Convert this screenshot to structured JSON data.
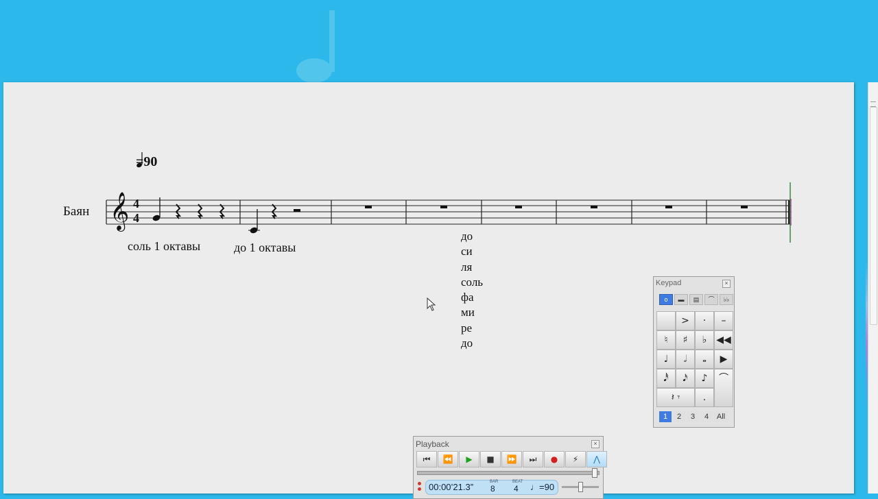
{
  "score": {
    "instrument": "Баян",
    "tempo_value": "=90",
    "time_signature": {
      "top": "4",
      "bottom": "4"
    },
    "lyrics": [
      "соль 1 октавы",
      "до 1 октавы"
    ],
    "solfege_column": [
      "до",
      "си",
      "ля",
      "соль",
      "фа",
      "ми",
      "ре",
      "до"
    ]
  },
  "keypad": {
    "title": "Keypad",
    "close": "×",
    "layout_tabs": [
      "o",
      "▬",
      "▤",
      "⌒",
      "♭♭"
    ],
    "keys": [
      [
        "",
        ">",
        "·",
        "–"
      ],
      [
        "♮",
        "♯",
        "♭",
        "◀◀"
      ],
      [
        "♩",
        "𝅗𝅥",
        "𝅝",
        "▶"
      ],
      [
        "𝅘𝅥𝅰",
        "𝅘𝅥𝅯",
        "♪",
        ""
      ],
      [
        "𝄽 𝄾",
        "",
        ".",
        "⌒"
      ]
    ],
    "number_tabs": [
      "1",
      "2",
      "3",
      "4",
      "All"
    ],
    "active_number_tab": "1"
  },
  "playback": {
    "title": "Playback",
    "close": "×",
    "buttons": [
      "⏮",
      "⏪",
      "▶",
      "■",
      "⏩",
      "⏭",
      "●",
      "⚡",
      "⋀"
    ],
    "time": "00:00’21.3”",
    "bar_label": "BAR",
    "bar_value": "8",
    "beat_label": "BEAT",
    "beat_value": "4",
    "tempo_display": "♩=90"
  }
}
